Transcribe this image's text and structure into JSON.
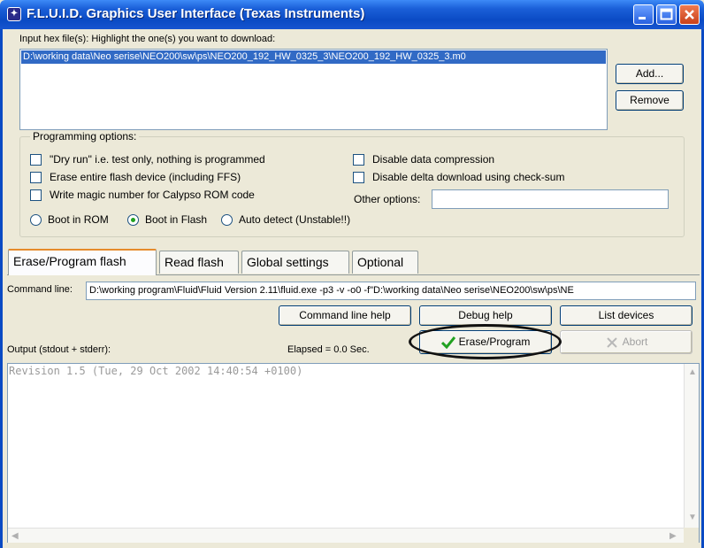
{
  "window": {
    "title": "F.L.U.I.D. Graphics User Interface (Texas Instruments)",
    "icon": "fluid-app-icon"
  },
  "files": {
    "label": "Input hex file(s): Highlight the one(s) you want to download:",
    "selected_file": "D:\\working data\\Neo serise\\NEO200\\sw\\ps\\NEO200_192_HW_0325_3\\NEO200_192_HW_0325_3.m0",
    "add_label": "Add...",
    "remove_label": "Remove"
  },
  "programming": {
    "legend": "Programming options:",
    "dry_run": "\"Dry run\" i.e. test only, nothing is programmed",
    "erase_entire": "Erase entire flash device (including FFS)",
    "write_magic": "Write magic number for Calypso ROM code",
    "disable_compression": "Disable data compression",
    "disable_delta": "Disable delta download using check-sum",
    "other_options_label": "Other options:",
    "other_options_value": "",
    "boot_rom": "Boot in ROM",
    "boot_flash": "Boot in Flash",
    "auto_detect": "Auto detect (Unstable!!)",
    "selected_boot": "Boot in Flash"
  },
  "tabs": [
    {
      "label": "Erase/Program flash",
      "active": true
    },
    {
      "label": "Read flash",
      "active": false
    },
    {
      "label": "Global settings",
      "active": false
    },
    {
      "label": "Optional",
      "active": false
    }
  ],
  "command": {
    "label": "Command line:",
    "value": "D:\\working program\\Fluid\\Fluid Version 2.11\\fluid.exe -p3 -v -o0 -f\"D:\\working data\\Neo serise\\NEO200\\sw\\ps\\NE",
    "help_label": "Command line help",
    "debug_label": "Debug help",
    "list_label": "List devices"
  },
  "output": {
    "label": "Output (stdout + stderr):",
    "elapsed": "Elapsed = 0.0 Sec.",
    "erase_program_label": "Erase/Program",
    "abort_label": "Abort",
    "text": "Revision 1.5 (Tue, 29 Oct 2002 14:40:54 +0100)"
  },
  "colors": {
    "titlebar": "#0a4ac4",
    "selection": "#316ac5",
    "check_green": "#21a121"
  }
}
